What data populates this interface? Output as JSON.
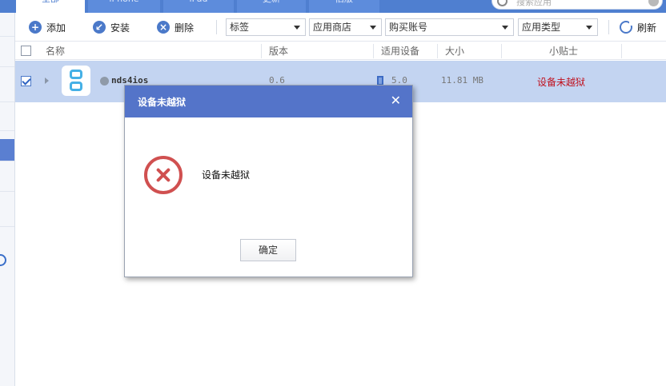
{
  "tabs": [
    {
      "label": "全部",
      "active": true
    },
    {
      "label": "iPhone",
      "active": false
    },
    {
      "label": "iPad",
      "active": false
    },
    {
      "label": "更新",
      "active": false
    },
    {
      "label": "旧版",
      "active": false
    }
  ],
  "search": {
    "placeholder": "搜索应用"
  },
  "toolbar": {
    "add_label": "添加",
    "install_label": "安装",
    "delete_label": "删除",
    "tag_filter": "标签",
    "store_filter": "应用商店",
    "account_filter": "购买账号",
    "type_filter": "应用类型",
    "refresh_label": "刷新"
  },
  "table": {
    "columns": [
      "名称",
      "版本",
      "适用设备",
      "大小",
      "小贴士"
    ],
    "rows": [
      {
        "selected": true,
        "name": "nds4ios",
        "version": "0.6",
        "device": "5.0",
        "size": "11.81 MB",
        "note": "设备未越狱"
      }
    ]
  },
  "dialog": {
    "title": "设备未越狱",
    "message": "设备未越狱",
    "ok_label": "确定",
    "icon": "error-x-icon"
  },
  "colors": {
    "accent": "#5474c9",
    "row_selected": "#c3d4f1",
    "error": "#d05050",
    "note_red": "#c0111e"
  }
}
